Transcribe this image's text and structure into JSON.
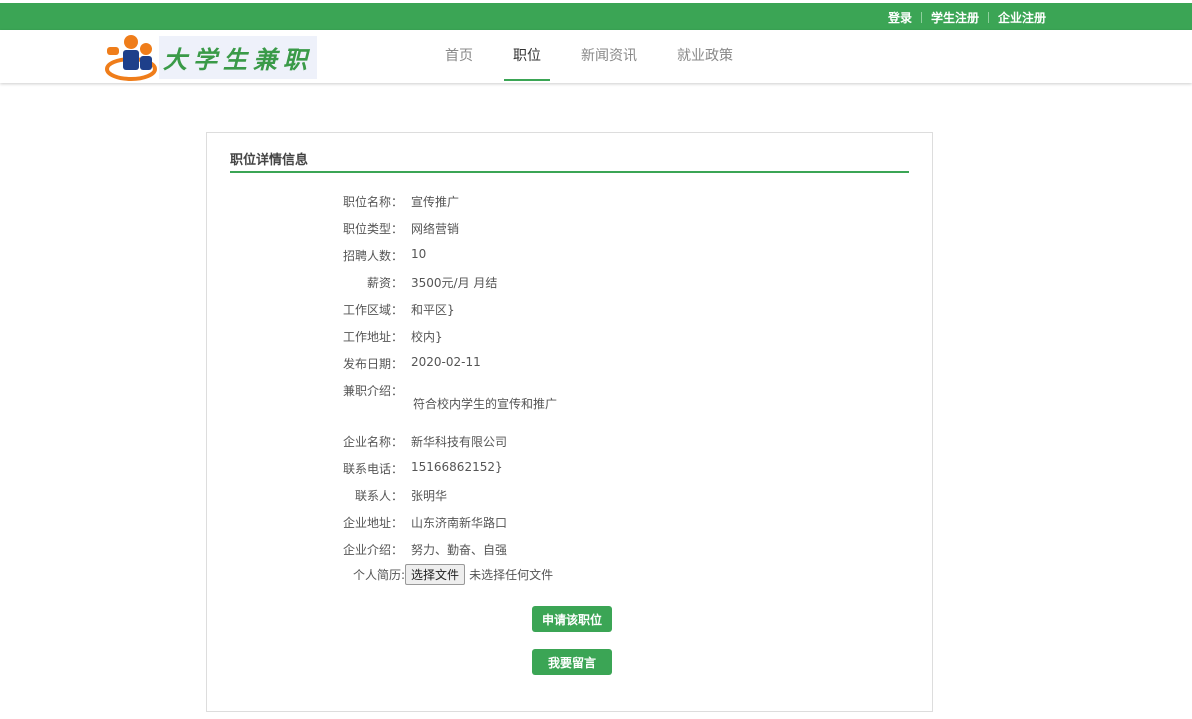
{
  "topbar": {
    "login": "登录",
    "student_register": "学生注册",
    "company_register": "企业注册"
  },
  "logo": {
    "text": "大学生兼职"
  },
  "nav": [
    {
      "label": "首页"
    },
    {
      "label": "职位"
    },
    {
      "label": "新闻资讯"
    },
    {
      "label": "就业政策"
    }
  ],
  "card": {
    "title": "职位详情信息",
    "fields": [
      {
        "label": "职位名称：",
        "value": "宣传推广"
      },
      {
        "label": "职位类型：",
        "value": "网络营销"
      },
      {
        "label": "招聘人数：",
        "value": "10"
      },
      {
        "label": "薪资：",
        "value": "3500元/月  月结"
      },
      {
        "label": "工作区域：",
        "value": "和平区}"
      },
      {
        "label": "工作地址：",
        "value": "校内}"
      },
      {
        "label": "发布日期：",
        "value": "2020-02-11"
      },
      {
        "label": "兼职介绍：",
        "value": ""
      }
    ],
    "intro": "符合校内学生的宣传和推广",
    "company": [
      {
        "label": "企业名称：",
        "value": "新华科技有限公司"
      },
      {
        "label": "联系电话：",
        "value": "15166862152}"
      },
      {
        "label": "联系人：",
        "value": "张明华"
      },
      {
        "label": "企业地址：",
        "value": "山东济南新华路口"
      },
      {
        "label": "企业介绍：",
        "value": "努力、勤奋、自强"
      }
    ],
    "resume_label": "个人简历:",
    "choose_file": "选择文件",
    "no_file": "未选择任何文件",
    "apply_button": "申请该职位",
    "message_button": "我要留言"
  }
}
